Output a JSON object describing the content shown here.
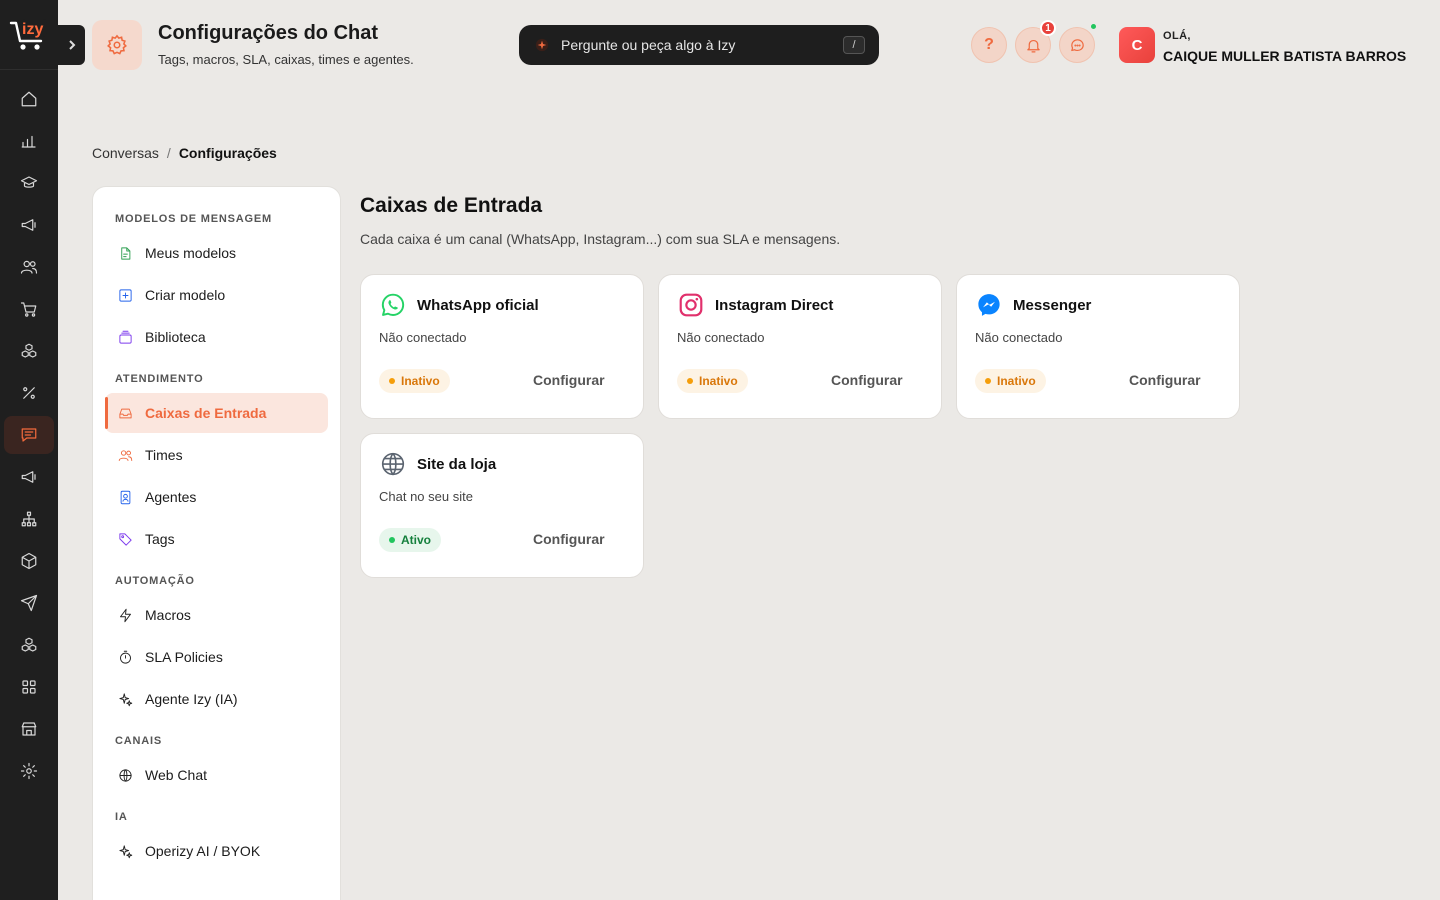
{
  "brand": {
    "logo_text": "izy",
    "accent": "#ef6a3f"
  },
  "rail": {
    "icons": [
      "home-icon",
      "bar-chart-icon",
      "graduation-cap-icon",
      "megaphone-icon",
      "users-icon",
      "cart-icon",
      "boxes-icon",
      "percent-icon",
      "chat-icon",
      "megaphone-2-icon",
      "hierarchy-icon",
      "package-icon",
      "send-icon",
      "blocks-icon",
      "grid-icon",
      "store-icon",
      "gear-icon"
    ],
    "active": "chat-icon"
  },
  "header": {
    "title": "Configurações do Chat",
    "subtitle": "Tags, macros, SLA, caixas, times e agentes.",
    "search_placeholder": "Pergunte ou peça algo à Izy",
    "search_kbd": "/",
    "help": "?",
    "notif_count": "1",
    "greeting": "OLÁ,",
    "user_initial": "C",
    "user_name": "CAIQUE MULLER BATISTA BARROS"
  },
  "breadcrumb": {
    "parent": "Conversas",
    "sep": "/",
    "current": "Configurações"
  },
  "menu": {
    "sections": [
      {
        "title": "MODELOS DE MENSAGEM",
        "items": [
          "Meus modelos",
          "Criar modelo",
          "Biblioteca"
        ]
      },
      {
        "title": "ATENDIMENTO",
        "items": [
          "Caixas de Entrada",
          "Times",
          "Agentes",
          "Tags"
        ]
      },
      {
        "title": "AUTOMAÇÃO",
        "items": [
          "Macros",
          "SLA Policies",
          "Agente Izy (IA)"
        ]
      },
      {
        "title": "CANAIS",
        "items": [
          "Web Chat"
        ]
      },
      {
        "title": "IA",
        "items": [
          "Operizy AI / BYOK"
        ]
      }
    ],
    "active": "Caixas de Entrada"
  },
  "content": {
    "title": "Caixas de Entrada",
    "subtitle": "Cada caixa é um canal (WhatsApp, Instagram...) com sua SLA e mensagens.",
    "cards": [
      {
        "name": "WhatsApp oficial",
        "desc": "Não conectado",
        "status": "Inativo",
        "action": "Configurar"
      },
      {
        "name": "Instagram Direct",
        "desc": "Não conectado",
        "status": "Inativo",
        "action": "Configurar"
      },
      {
        "name": "Messenger",
        "desc": "Não conectado",
        "status": "Inativo",
        "action": "Configurar"
      },
      {
        "name": "Site da loja",
        "desc": "Chat no seu site",
        "status": "Ativo",
        "action": "Configurar"
      }
    ]
  }
}
